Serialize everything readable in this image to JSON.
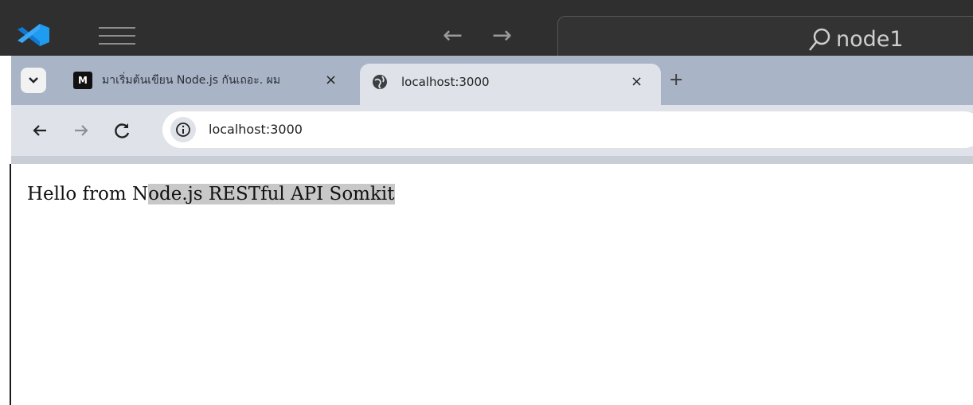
{
  "vscode": {
    "search_text": "node1",
    "icons": [
      "vscode-logo",
      "hamburger-menu-icon",
      "back-arrow-icon",
      "forward-arrow-icon",
      "search-icon"
    ]
  },
  "browser": {
    "tabs": [
      {
        "favicon_text": "M",
        "title": "มาเริ่มต้นเขียน Node.js กันเถอะ. ผม",
        "active": false
      },
      {
        "favicon": "globe-icon",
        "title": "localhost:3000",
        "active": true
      }
    ],
    "new_tab_label": "+",
    "close_label": "×",
    "address": "localhost:3000"
  },
  "page": {
    "text_before_selection": "Hello from N",
    "text_selected": "ode.js RESTful API Somkit"
  },
  "colors": {
    "vscode_bar": "#2f2f2f",
    "vscode_accent": "#1f9cf0",
    "tab_strip": "#a9b4c6",
    "toolbar": "#dfe3e9",
    "selection": "#c8c8c8"
  }
}
